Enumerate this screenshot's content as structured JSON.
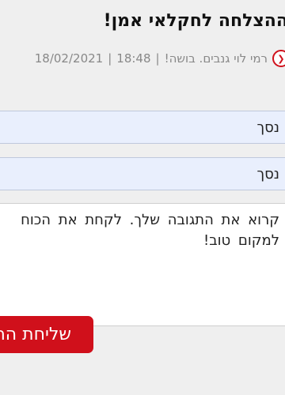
{
  "article": {
    "title": "ההצלחה לחקלאי אמן!",
    "author_line": "רמי לוי גנבים. בושה!",
    "time": "18:48",
    "date": "18/02/2021",
    "separator": "|"
  },
  "form": {
    "name_value": "נסך",
    "email_value": "נסך",
    "body_line1": "קרוא את התגובה שלך. לקחת את הכוח",
    "body_line2": "למקום טוב!",
    "submit_label": "שליחת התגובה"
  },
  "colors": {
    "accent": "#d0101b",
    "field_bg": "#e9effd",
    "page_bg": "#efefef"
  },
  "icons": {
    "author_icon": "circle-arrow-icon"
  }
}
